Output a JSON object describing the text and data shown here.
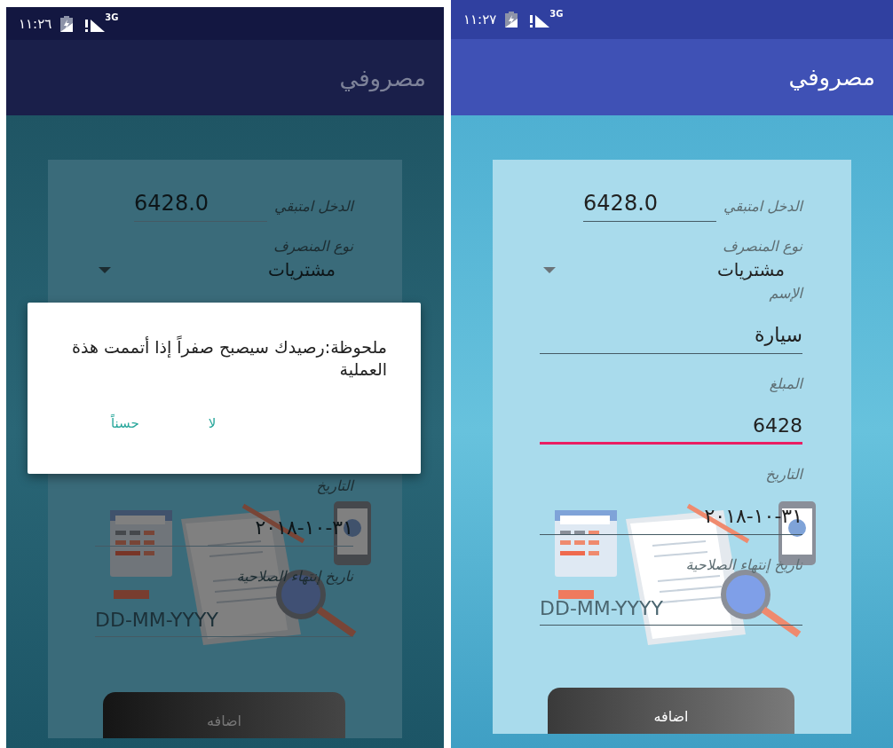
{
  "screens": [
    {
      "dimmed": false,
      "status_bar": {
        "time": "١١:٢٧",
        "network": "3G"
      },
      "app_bar": {
        "title": "مصروفي"
      },
      "form": {
        "fields": [
          {
            "kind": "balance",
            "label": "الدخل امتبقي",
            "value": "6428.0"
          },
          {
            "kind": "dropdown",
            "label": "نوع المنصرف",
            "value": "مشتريات"
          },
          {
            "kind": "input",
            "label": "الإسم",
            "value": "سيارة",
            "focused": false
          },
          {
            "kind": "input",
            "label": "المبلغ",
            "value": "6428",
            "focused": true
          },
          {
            "kind": "input",
            "label": "التاريخ",
            "value": "٣١-١٠-٢٠١٨",
            "focused": false
          },
          {
            "kind": "input",
            "label": "ناريخ إنتهاء الصلاحية",
            "placeholder": "DD-MM-YYYY",
            "focused": false
          }
        ],
        "submit": "اضافه"
      }
    },
    {
      "dimmed": true,
      "status_bar": {
        "time": "١١:٢٦",
        "network": "3G"
      },
      "app_bar": {
        "title": "مصروفي"
      },
      "form": {
        "fields": [
          {
            "kind": "balance",
            "label": "الدخل امتبقي",
            "value": "6428.0"
          },
          {
            "kind": "dropdown",
            "label": "نوع المنصرف",
            "value": "مشتريات"
          },
          {
            "kind": "input",
            "label": "التاريخ",
            "value": "٣١-١٠-٢٠١٨",
            "focused": false
          },
          {
            "kind": "input",
            "label": "ناريخ إنتهاء الصلاحية",
            "placeholder": "DD-MM-YYYY",
            "focused": false
          }
        ],
        "submit": "اضافه"
      },
      "dialog": {
        "message": "ملحوظة:رصيدك سيصبح صفراً إذا أتممت هذة العملية",
        "buttons": [
          "لا",
          "حسناً"
        ]
      }
    }
  ]
}
